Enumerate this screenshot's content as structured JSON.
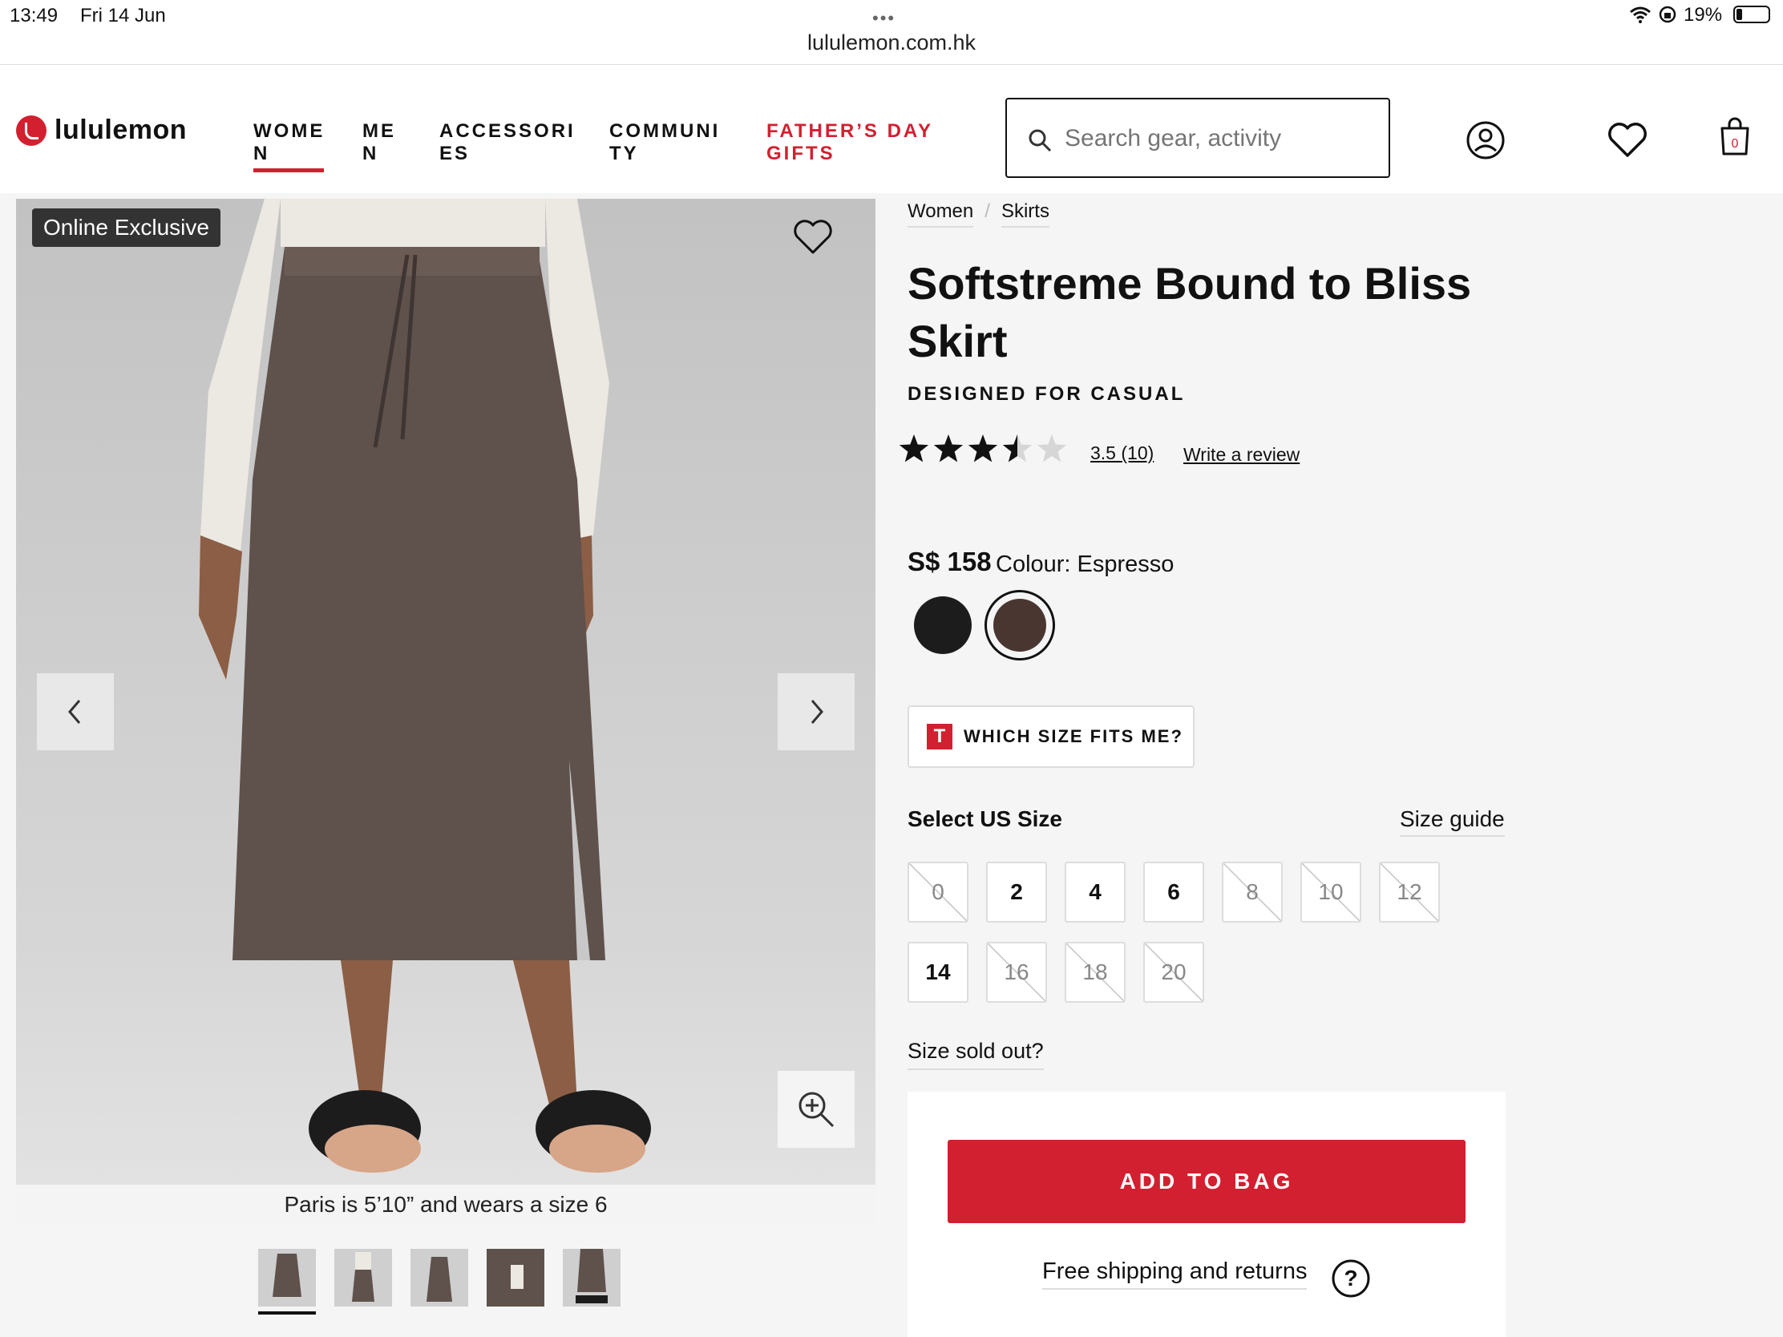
{
  "status_bar": {
    "time": "13:49",
    "date": "Fri 14 Jun",
    "dots": "•••",
    "url": "lululemon.com.hk",
    "battery": "19%",
    "battery_level": 0.19
  },
  "header": {
    "logo_text": "lululemon",
    "nav": [
      {
        "label": "WOMEN"
      },
      {
        "label": "MEN"
      },
      {
        "label": "ACCESSORIES"
      },
      {
        "label": "COMMUNITY"
      },
      {
        "label": "FATHER’S DAY GIFTS"
      }
    ],
    "search_placeholder": "Search gear, activity",
    "bag_count": "0",
    "icons": [
      "search-icon",
      "account-icon",
      "heart-icon",
      "bag-icon"
    ]
  },
  "gallery": {
    "badge": "Online Exclusive",
    "caption": "Paris is 5’10” and wears a size 6",
    "thumbnail_count": 5,
    "selected_thumbnail": 1
  },
  "product": {
    "breadcrumb": [
      "Women",
      "Skirts"
    ],
    "title": "Softstreme Bound to Bliss Skirt",
    "subtitle": "DESIGNED FOR CASUAL",
    "rating": 3.5,
    "rating_text": "3.5",
    "review_count": "(10)",
    "write_review": "Write a review",
    "price": "S$ 158",
    "colour_label": "Colour: Espresso",
    "swatches": [
      {
        "name": "Black",
        "color": "#1c1c1c"
      },
      {
        "name": "Espresso",
        "color": "#4a3631",
        "selected": true
      }
    ],
    "fit_button": "WHICH SIZE FITS ME?",
    "size_heading": "Select US Size",
    "size_guide": "Size guide",
    "sizes": [
      {
        "label": "0",
        "sold_out": true
      },
      {
        "label": "2",
        "sold_out": false
      },
      {
        "label": "4",
        "sold_out": false
      },
      {
        "label": "6",
        "sold_out": false
      },
      {
        "label": "8",
        "sold_out": true
      },
      {
        "label": "10",
        "sold_out": true
      },
      {
        "label": "12",
        "sold_out": true
      },
      {
        "label": "14",
        "sold_out": false
      },
      {
        "label": "16",
        "sold_out": true
      },
      {
        "label": "18",
        "sold_out": true
      },
      {
        "label": "20",
        "sold_out": true
      }
    ],
    "sold_out_link": "Size sold out?",
    "add_to_bag": "ADD TO BAG",
    "shipping": "Free shipping and returns"
  },
  "colors": {
    "brand_red": "#d22030"
  }
}
